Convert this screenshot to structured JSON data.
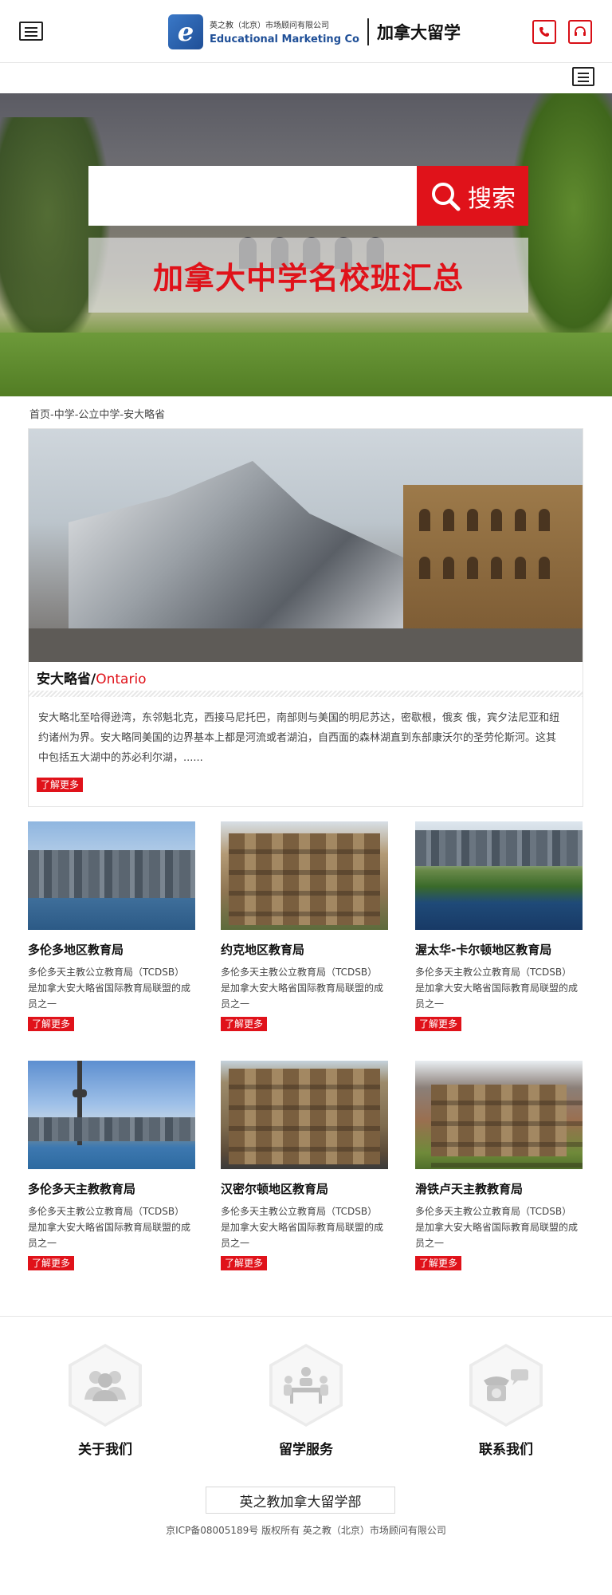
{
  "header": {
    "logo_letter": "e",
    "logo_company_cn": "英之教（北京）市场顾问有限公司",
    "logo_company_en": "Educational Marketing Co",
    "site_title": "加拿大留学",
    "icons": [
      "menu-icon",
      "phone-icon",
      "headset-icon",
      "menu-icon"
    ]
  },
  "search": {
    "value": "",
    "placeholder": "",
    "button_label": "搜索"
  },
  "banner": {
    "title": "加拿大中学名校班汇总"
  },
  "breadcrumb": {
    "text": "首页-中学-公立中学-安大略省"
  },
  "province": {
    "title_cn": "安大略省/",
    "title_en": "Ontario",
    "description": "安大略北至哈得逊湾，东邻魁北克，西接马尼托巴，南部则与美国的明尼苏达，密歇根，俄亥 俄，宾夕法尼亚和纽约诸州为界。安大略同美国的边界基本上都是河流或者湖泊，自西面的森林湖直到东部康沃尔的圣劳伦斯河。这其中包括五大湖中的苏必利尔湖，......",
    "more_label": "了解更多"
  },
  "boards": [
    {
      "name": "多伦多地区教育局",
      "desc": "多伦多天主教公立教育局（TCDSB）是加拿大安大略省国际教育局联盟的成员之一",
      "more": "了解更多"
    },
    {
      "name": "约克地区教育局",
      "desc": "多伦多天主教公立教育局（TCDSB）是加拿大安大略省国际教育局联盟的成员之一",
      "more": "了解更多"
    },
    {
      "name": "渥太华-卡尔顿地区教育局",
      "desc": "多伦多天主教公立教育局（TCDSB）是加拿大安大略省国际教育局联盟的成员之一",
      "more": "了解更多"
    },
    {
      "name": "多伦多天主教教育局",
      "desc": "多伦多天主教公立教育局（TCDSB）是加拿大安大略省国际教育局联盟的成员之一",
      "more": "了解更多"
    },
    {
      "name": "汉密尔顿地区教育局",
      "desc": "多伦多天主教公立教育局（TCDSB）是加拿大安大略省国际教育局联盟的成员之一",
      "more": "了解更多"
    },
    {
      "name": "滑铁卢天主教教育局",
      "desc": "多伦多天主教公立教育局（TCDSB）是加拿大安大略省国际教育局联盟的成员之一",
      "more": "了解更多"
    }
  ],
  "footer": {
    "nav": [
      {
        "label": "关于我们",
        "icon": "people-icon"
      },
      {
        "label": "留学服务",
        "icon": "meeting-icon"
      },
      {
        "label": "联系我们",
        "icon": "telephone-icon"
      }
    ],
    "department": "英之教加拿大留学部",
    "copyright": "京ICP备08005189号 版权所有 英之教（北京）市场顾问有限公司"
  },
  "colors": {
    "accent": "#e0121a",
    "logo_blue": "#1f4f97"
  }
}
